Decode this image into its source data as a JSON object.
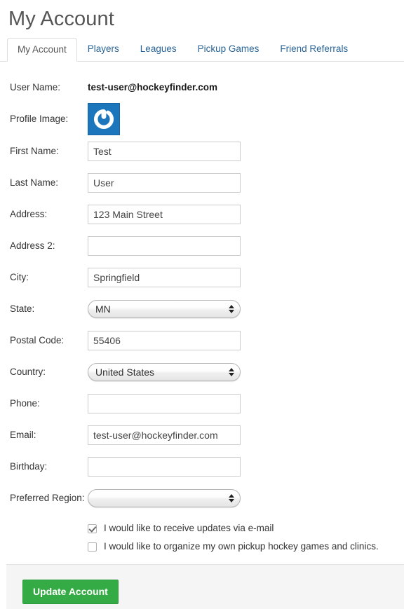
{
  "page": {
    "title": "My Account"
  },
  "tabs": [
    {
      "label": "My Account",
      "active": true
    },
    {
      "label": "Players",
      "active": false
    },
    {
      "label": "Leagues",
      "active": false
    },
    {
      "label": "Pickup Games",
      "active": false
    },
    {
      "label": "Friend Referrals",
      "active": false
    }
  ],
  "form": {
    "user_name": {
      "label": "User Name:",
      "value": "test-user@hockeyfinder.com"
    },
    "profile_image": {
      "label": "Profile Image:",
      "icon": "gravatar-logo-icon",
      "color": "#1c76bc"
    },
    "first_name": {
      "label": "First Name:",
      "value": "Test",
      "placeholder": ""
    },
    "last_name": {
      "label": "Last Name:",
      "value": "User",
      "placeholder": ""
    },
    "address": {
      "label": "Address:",
      "value": "123 Main Street",
      "placeholder": ""
    },
    "address2": {
      "label": "Address 2:",
      "value": "",
      "placeholder": ""
    },
    "city": {
      "label": "City:",
      "value": "Springfield",
      "placeholder": ""
    },
    "state": {
      "label": "State:",
      "value": "MN"
    },
    "postal_code": {
      "label": "Postal Code:",
      "value": "55406",
      "placeholder": ""
    },
    "country": {
      "label": "Country:",
      "value": "United States"
    },
    "phone": {
      "label": "Phone:",
      "value": "",
      "placeholder": ""
    },
    "email": {
      "label": "Email:",
      "value": "test-user@hockeyfinder.com",
      "placeholder": ""
    },
    "birthday": {
      "label": "Birthday:",
      "value": "",
      "placeholder": ""
    },
    "preferred_region": {
      "label": "Preferred Region:",
      "value": ""
    }
  },
  "checkboxes": [
    {
      "label": "I would like to receive updates via e-mail",
      "checked": true
    },
    {
      "label": "I would like to organize my own pickup hockey games and clinics.",
      "checked": false
    }
  ],
  "footer": {
    "update_label": "Update Account",
    "button_color": "#35ab46"
  }
}
